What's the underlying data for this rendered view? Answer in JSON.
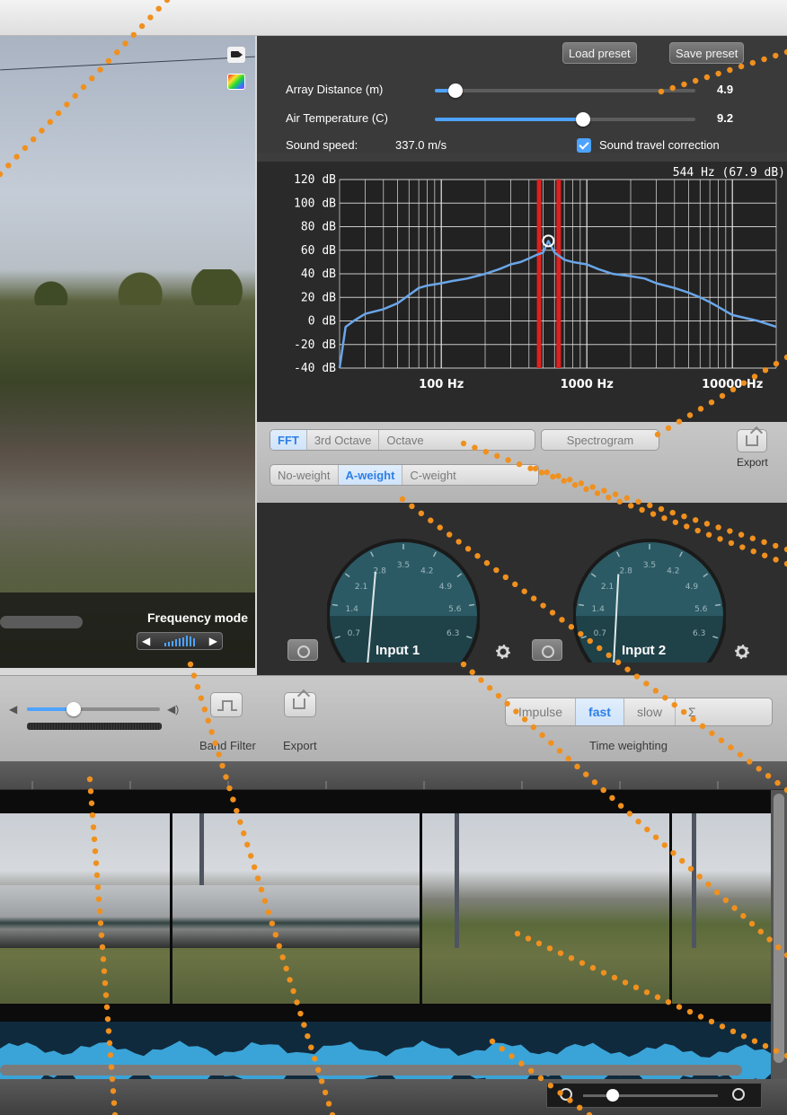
{
  "video": {
    "frequency_mode_label": "Frequency mode",
    "frequency_mode_value": 0.55
  },
  "presets": {
    "load_label": "Load preset",
    "save_label": "Save preset"
  },
  "array_distance": {
    "label": "Array Distance (m)",
    "value": "4.9",
    "fraction": 0.08
  },
  "air_temperature": {
    "label": "Air Temperature (C)",
    "value": "9.2",
    "fraction": 0.57
  },
  "sound_speed": {
    "label": "Sound speed:",
    "value": "337.0 m/s"
  },
  "sound_travel_correction": {
    "label": "Sound travel correction",
    "checked": true
  },
  "chart_data": {
    "type": "line",
    "title": "",
    "annotation": "544 Hz (67.9 dB)",
    "xlabel": "",
    "ylabel": "",
    "x_scale": "log",
    "xlim": [
      20,
      20000
    ],
    "ylim": [
      -40,
      120
    ],
    "x_ticks": [
      "100 Hz",
      "1000 Hz",
      "10000 Hz"
    ],
    "x_tick_values": [
      100,
      1000,
      10000
    ],
    "y_ticks": [
      "120 dB",
      "100 dB",
      "80 dB",
      "60 dB",
      "40 dB",
      "20 dB",
      "0 dB",
      "-20 dB",
      "-40 dB"
    ],
    "y_tick_values": [
      120,
      100,
      80,
      60,
      40,
      20,
      0,
      -20,
      -40
    ],
    "grid": true,
    "highlight_band_hz": [
      470,
      640
    ],
    "marker": {
      "x": 544,
      "y": 67.9
    },
    "series": [
      {
        "color": "#6aa6e8",
        "x": [
          20,
          22,
          25,
          30,
          40,
          50,
          60,
          70,
          80,
          100,
          120,
          150,
          200,
          250,
          300,
          350,
          400,
          450,
          500,
          544,
          600,
          700,
          800,
          1000,
          1200,
          1500,
          2000,
          2500,
          3000,
          4000,
          5000,
          6000,
          7000,
          8000,
          10000,
          15000,
          20000
        ],
        "y": [
          -40,
          -5,
          0,
          6,
          10,
          15,
          22,
          28,
          30,
          32,
          34,
          36,
          40,
          44,
          48,
          50,
          53,
          56,
          58,
          67.9,
          58,
          52,
          50,
          48,
          44,
          40,
          38,
          36,
          32,
          28,
          24,
          20,
          16,
          12,
          5,
          0,
          -5
        ]
      }
    ]
  },
  "spectrum_modes": [
    "FFT",
    "3rd Octave",
    "Octave"
  ],
  "spectrum_mode_active": "FFT",
  "spectrogram_label": "Spectrogram",
  "weightings": [
    "No-weight",
    "A-weight",
    "C-weight"
  ],
  "weighting_active": "A-weight",
  "export_label": "Export",
  "meters": [
    {
      "label": "Input 1",
      "scale": [
        "0.7",
        "1.4",
        "2.1",
        "2.8",
        "3.5",
        "4.2",
        "4.9",
        "5.6",
        "6.3"
      ],
      "reading": "---",
      "needle": 0.35
    },
    {
      "label": "Input 2",
      "scale": [
        "0.7",
        "1.4",
        "2.1",
        "2.8",
        "3.5",
        "4.2",
        "4.9",
        "5.6",
        "6.3"
      ],
      "reading": "---",
      "needle": 0.33
    }
  ],
  "playback": {
    "volume": 0.35
  },
  "toolbar": {
    "band_filter_label": "Band Filter",
    "export_label": "Export",
    "time_weighting_label": "Time weighting",
    "time_weighting_options": [
      "Impulse",
      "fast",
      "slow",
      "Σ"
    ],
    "time_weighting_active": "fast"
  },
  "zoom": {
    "level": 0.22
  },
  "colors": {
    "accent": "#4da3ff",
    "highlight_band": "#e02020",
    "callout_dots": "#f0901e"
  }
}
